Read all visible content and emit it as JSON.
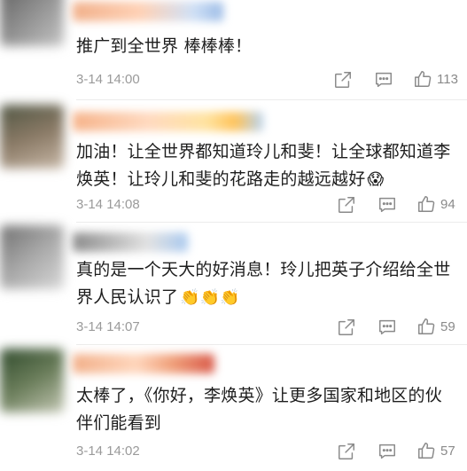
{
  "comments": [
    {
      "text": "推广到全世界 棒棒棒！",
      "emoji": "",
      "time": "3-14 14:00",
      "likes": "113",
      "avatar_colors": [
        "#6b6b6b",
        "#b8b8b8"
      ],
      "username_colors": [
        "#e89b6a",
        "#8fb3e0"
      ]
    },
    {
      "text": "加油！让全世界都知道玲儿和斐！让全球都知道李焕英！让玲儿和斐的花路走的越远越好",
      "emoji": "😱",
      "time": "3-14 14:08",
      "likes": "94",
      "avatar_colors": [
        "#5b5f4a",
        "#a48d7a"
      ],
      "username_colors": [
        "#f0a070",
        "#f5c86a"
      ]
    },
    {
      "text": "真的是一个天大的好消息！玲儿把英子介绍给全世界人民认识了",
      "emoji": "👏👏👏",
      "time": "3-14 14:07",
      "likes": "59",
      "avatar_colors": [
        "#7d7d7d",
        "#c9c9c9"
      ],
      "username_colors": [
        "#9a9a9a",
        "#a8c8f0"
      ]
    },
    {
      "text": "太棒了，《你好，李焕英》让更多国家和地区的伙伴们能看到",
      "emoji": "",
      "time": "3-14 14:02",
      "likes": "57",
      "avatar_colors": [
        "#3d5a3a",
        "#9aa88a"
      ],
      "username_colors": [
        "#f2a57a",
        "#e06a5a"
      ]
    }
  ],
  "icons": {
    "share": "share-icon",
    "reply": "comment-icon",
    "like": "thumbs-up-icon"
  }
}
